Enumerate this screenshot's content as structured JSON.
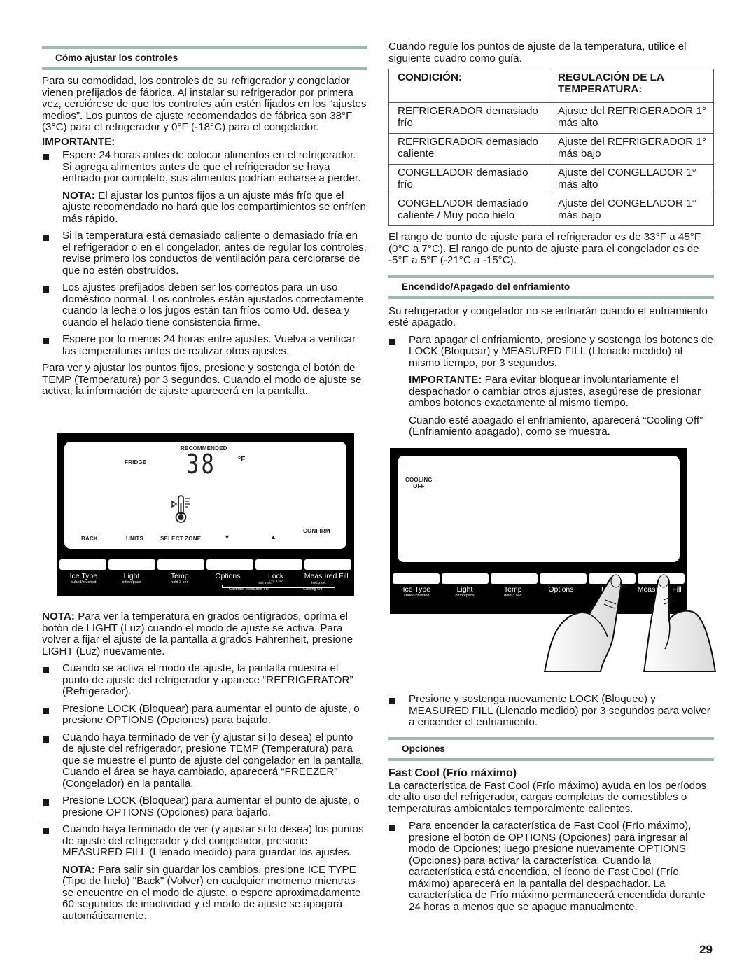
{
  "left": {
    "section1_heading": "Cómo ajustar los controles",
    "intro": "Para su comodidad, los controles de su refrigerador y congelador vienen prefijados de fábrica. Al instalar su refrigerador por primera vez, cerciórese de que los controles aún estén fijados en los “ajustes medios”. Los puntos de ajuste recomendados de fábrica son 38°F (3°C) para el refrigerador y 0°F (-18°C) para el congelador.",
    "importante_label": "IMPORTANTE:",
    "bullets1": [
      "Espere 24 horas antes de colocar alimentos en el refrigerador. Si agrega alimentos antes de que el refrigerador se haya enfriado por completo, sus alimentos podrían echarse a perder.",
      "Si la temperatura está demasiado caliente o demasiado fría en el refrigerador o en el congelador, antes de regular los controles, revise primero los conductos de ventilación para cerciorarse de que no estén obstruidos.",
      "Los ajustes prefijados deben ser los correctos para un uso doméstico normal. Los controles están ajustados correctamente cuando la leche o los jugos están tan fríos como Ud. desea y cuando el helado tiene consistencia firme.",
      "Espere por lo menos 24 horas entre ajustes. Vuelva a verificar las temperaturas antes de realizar otros ajustes."
    ],
    "nota1_label": "NOTA:",
    "nota1_text": " El ajustar los puntos fijos a un ajuste más frío que el ajuste recomendado no hará que los compartimientos se enfríen más rápido.",
    "para_ver": "Para ver y ajustar los puntos fijos, presione y sostenga el botón de TEMP (Temperatura) por 3 segundos. Cuando el modo de ajuste se activa, la información de ajuste aparecerá en la pantalla.",
    "nota2_label": "NOTA:",
    "nota2_text": " Para ver la temperatura en grados centígrados, oprima el botón de LIGHT (Luz) cuando el modo de ajuste se activa. Para volver a fijar el ajuste de la pantalla a grados Fahrenheit, presione LIGHT (Luz) nuevamente.",
    "bullets2": [
      "Cuando se activa el modo de ajuste, la pantalla muestra el punto de ajuste del refrigerador y aparece “REFRIGERATOR” (Refrigerador).",
      "Presione LOCK (Bloquear) para aumentar el punto de ajuste, o presione OPTIONS (Opciones) para bajarlo.",
      "Cuando haya terminado de ver (y ajustar si lo desea) el punto de ajuste del refrigerador, presione TEMP (Temperatura) para que se muestre el punto de ajuste del congelador en la pantalla. Cuando el área se haya cambiado, aparecerá “FREEZER” (Congelador) en la pantalla.",
      "Presione LOCK (Bloquear) para aumentar el punto de ajuste, o presione OPTIONS (Opciones) para bajarlo.",
      "Cuando haya terminado de ver (y ajustar si lo desea) los puntos de ajuste del refrigerador y del congelador, presione MEASURED FILL (Llenado medido) para guardar los ajustes."
    ],
    "nota3_label": "NOTA:",
    "nota3_text": " Para salir sin guardar los cambios, presione ICE TYPE (Tipo de hielo) \"Back\" (Volver) en cualquier momento mientras se encuentre en el modo de ajuste, o espere aproximadamente 60 segundos de inactividad y el modo de ajuste se apagará automáticamente."
  },
  "display1": {
    "recommended": "RECOMMENDED",
    "zone": "FRIDGE",
    "temp_value": "38",
    "unit": "°F",
    "soft_keys": [
      "BACK",
      "UNITS",
      "SELECT ZONE",
      "▼",
      "▲",
      "CONFIRM"
    ],
    "icon": "thermometer-icon"
  },
  "buttons": [
    {
      "label": "Ice Type",
      "sub": "cubed/crushed"
    },
    {
      "label": "Light",
      "sub": "off/on/pads"
    },
    {
      "label": "Temp",
      "sub": "hold 3 sec"
    },
    {
      "label": "Options",
      "sub": ""
    },
    {
      "label": "Lock",
      "sub": "hold 3 sec"
    },
    {
      "label": "Measured Fill",
      "sub": ""
    }
  ],
  "combo_labels": {
    "hold_a": "hold 3 sec",
    "calibrate": "Calibrate Measured Fill",
    "hold_b": "hold 3 sec",
    "cooling_off": "Cooling Off"
  },
  "right": {
    "intro": "Cuando regule los puntos de ajuste de la temperatura, utilice el siguiente cuadro como guía.",
    "table": {
      "headers": [
        "CONDICIÓN:",
        "REGULACIÓN DE LA TEMPERATURA:"
      ],
      "rows": [
        [
          "REFRIGERADOR demasiado frío",
          "Ajuste del REFRIGERADOR 1° más alto"
        ],
        [
          "REFRIGERADOR demasiado caliente",
          "Ajuste del REFRIGERADOR 1° más bajo"
        ],
        [
          "CONGELADOR demasiado frío",
          "Ajuste del CONGELADOR 1° más alto"
        ],
        [
          "CONGELADOR demasiado caliente / Muy poco hielo",
          "Ajuste del CONGELADOR 1° más bajo"
        ]
      ]
    },
    "range": "El rango de punto de ajuste para el refrigerador es de 33°F a 45°F (0°C a 7°C). El rango de punto de ajuste para el congelador es de -5°F a 5°F (-21°C a -15°C).",
    "section2_heading": "Encendido/Apagado del enfriamiento",
    "cooling_intro": "Su refrigerador y congelador no se enfriarán cuando el enfriamiento esté apagado.",
    "cooling_bullet1": "Para apagar el enfriamiento, presione y sostenga los botones de LOCK (Bloquear) y MEASURED FILL (Llenado medido) al mismo tiempo, por 3 segundos.",
    "importante_label": "IMPORTANTE:",
    "importante_text": " Para evitar bloquear involuntariamente el despachador o cambiar otros ajustes, asegúrese de presionar ambos botones exactamente al mismo tiempo.",
    "cooling_shown": "Cuando esté apagado el enfriamiento, aparecerá “Cooling Off” (Enfriamiento apagado), como se muestra.",
    "cooling_bullet2": "Presione y sostenga nuevamente LOCK (Bloqueo) y MEASURED FILL (Llenado medido) por 3 segundos para volver a encender el enfriamiento.",
    "section3_heading": "Opciones",
    "fastcool_heading": "Fast Cool (Frío máximo)",
    "fastcool_intro": "La característica de Fast Cool (Frío máximo) ayuda en los períodos de alto uso del refrigerador, cargas completas de comestibles o temperaturas ambientales temporalmente calientes.",
    "fastcool_bullet": "Para encender la característica de Fast Cool (Frío máximo), presione el botón de OPTIONS (Opciones) para ingresar al modo de Opciones; luego presione nuevamente OPTIONS (Opciones) para activar la característica. Cuando la característica está encendida, el ícono de Fast Cool (Frío máximo) aparecerá en la pantalla del despachador. La característica de Frío máximo permanecerá encendida durante 24 horas a menos que se apague manualmente."
  },
  "display2": {
    "status_line1": "COOLING",
    "status_line2": "OFF"
  },
  "page_number": "29"
}
